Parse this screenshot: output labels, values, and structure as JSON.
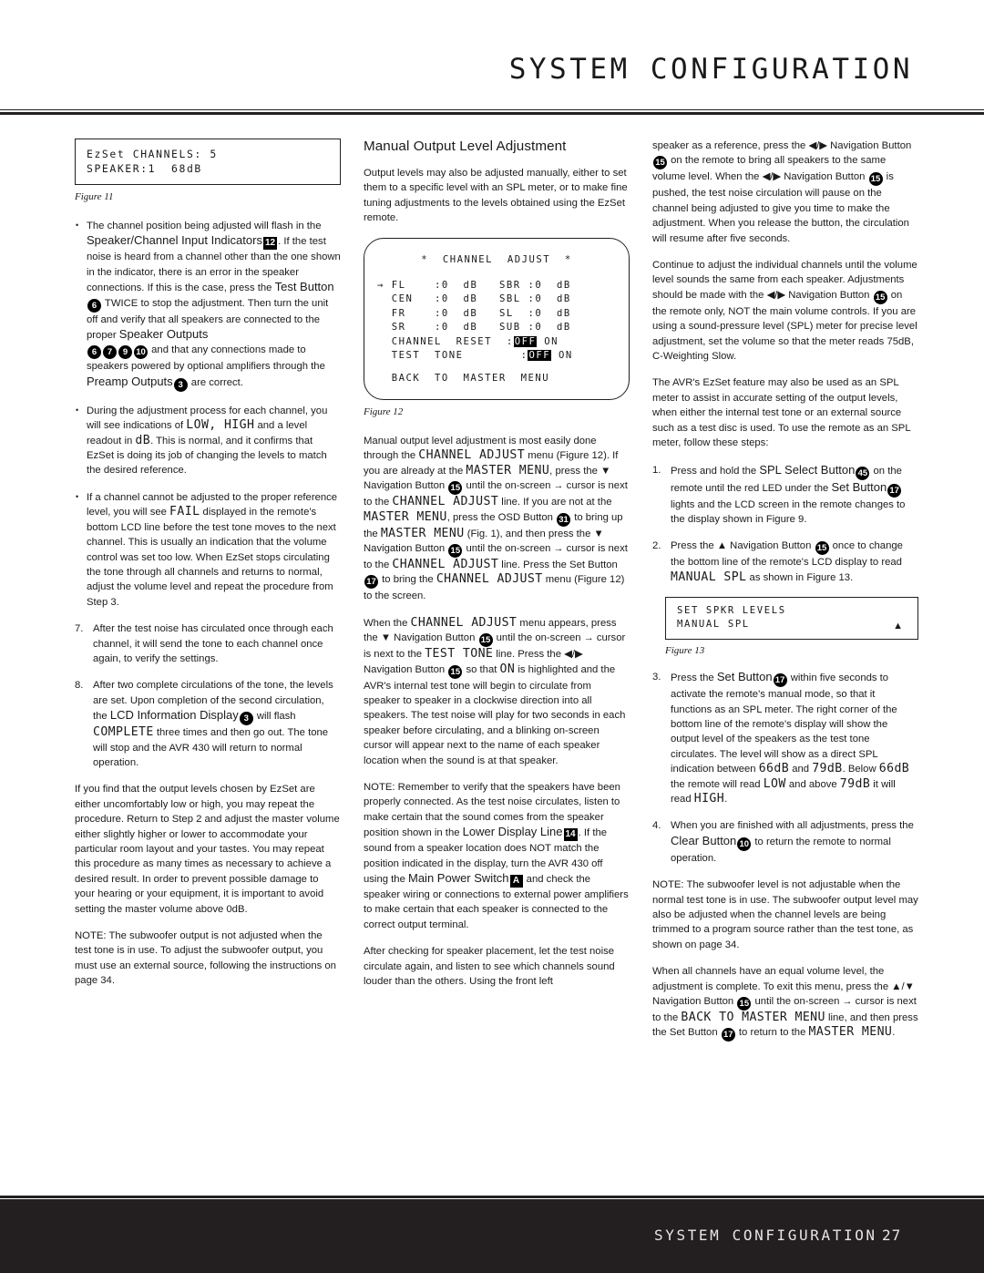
{
  "header": {
    "title": "SYSTEM CONFIGURATION"
  },
  "footer": {
    "title": "SYSTEM CONFIGURATION",
    "page_number": "27"
  },
  "figures": {
    "fig11": {
      "caption": "Figure 11",
      "line1": "EzSet CHANNELS: 5",
      "line2": "SPEAKER:1  68dB"
    },
    "fig12": {
      "caption": "Figure 12",
      "title": "*  CHANNEL  ADJUST  *",
      "cursor": "→",
      "rows": [
        {
          "left": "FL    :0  dB",
          "right": "SBR :0  dB"
        },
        {
          "left": "CEN   :0  dB",
          "right": "SBL :0  dB"
        },
        {
          "left": "FR    :0  dB",
          "right": "SL  :0  dB"
        },
        {
          "left": "SR    :0  dB",
          "right": "SUB :0  dB"
        }
      ],
      "channel_reset_label": "CHANNEL  RESET",
      "channel_reset_sep": ":",
      "channel_reset_selected": "OFF",
      "channel_reset_other": "ON",
      "test_tone_label": "TEST  TONE",
      "test_tone_sep": ":",
      "test_tone_selected": "OFF",
      "test_tone_other": "ON",
      "back_line": "BACK  TO  MASTER  MENU"
    },
    "fig13": {
      "caption": "Figure 13",
      "line1": "SET SPKR LEVELS",
      "line2": "MANUAL SPL",
      "arrow": "▲"
    }
  },
  "left_column": {
    "bullet1": {
      "t1": "The channel position being adjusted will flash in the ",
      "ui1": "Speaker/Channel Input Indicators",
      "ref1": "12",
      "t2": ". If the test noise is heard from a channel other than the one shown in the indicator, there is an error in the speaker connections. If this is the case, press the ",
      "ui2": "Test Button",
      "ref2": "6",
      "t3": " TWICE to stop the adjustment. Then turn the unit off and verify that all speakers are connected to the proper ",
      "ui3": "Speaker Outputs",
      "ref3": "6",
      "ref4": "7",
      "ref5": "9",
      "ref6": "10",
      "t4": " and that any connections made to speakers powered by optional amplifiers through the ",
      "ui4": "Preamp Outputs",
      "ref7": "3",
      "t5": " are correct."
    },
    "bullet2": {
      "t1": "During the adjustment process for each channel, you will see indications of ",
      "lcd1": "LOW, HIGH",
      "t2": " and a level readout in ",
      "lcd2": "dB",
      "t3": ". This is normal, and it confirms that EzSet is doing its job of changing the levels to match the desired reference."
    },
    "bullet3": {
      "t1": "If a channel cannot be adjusted to the proper reference level, you will see ",
      "lcd1": "FAIL",
      "t2": " displayed in the remote's bottom LCD line before the test tone moves to the next channel. This is usually an indication that the volume control was set too low. When EzSet stops circulating the tone through all channels and returns to normal, adjust the volume level and repeat the procedure from Step 3."
    },
    "step7": {
      "num": "7.",
      "text": "After the test noise has circulated once through each channel, it will send the tone to each channel once again, to verify the settings."
    },
    "step8": {
      "num": "8.",
      "t1": "After two complete circulations of the tone, the levels are set. Upon completion of the second circulation, the ",
      "ui1": "LCD Information Display",
      "ref1": "3",
      "t2": " will flash ",
      "lcd1": "COMPLETE",
      "t3": " three times and then go out. The tone will stop and the AVR 430 will return to normal operation."
    },
    "para_repeat": "If you find that the output levels chosen by EzSet are either uncomfortably low or high, you may repeat the procedure. Return to Step 2 and adjust the master volume either slightly higher or lower to accommodate your particular room layout and your tastes. You may repeat this procedure as many times as necessary to achieve a desired result. In order to prevent possible damage to your hearing or your equipment, it is important to avoid setting the master volume above 0dB.",
    "note_sub": "NOTE: The subwoofer output is not adjusted when the test tone is in use. To adjust the subwoofer output, you must use an external source, following the instructions on page 34."
  },
  "middle_column": {
    "heading": "Manual Output Level Adjustment",
    "intro": "Output levels may also be adjusted manually, either to set them to a specific level with an SPL meter, or to make fine tuning adjustments to the levels obtained using the EzSet remote.",
    "para_menu": {
      "t1": "Manual output level adjustment is most easily done through the ",
      "lcd1": "CHANNEL ADJUST",
      "t2": " menu (Figure 12). If you are already at the ",
      "lcd2": "MASTER MENU",
      "t3": ", press the ",
      "tri_down": "▼",
      "t4": " Navigation Button ",
      "ref1": "15",
      "t5": " until the on-screen ",
      "arrow": "→",
      "t6": " cursor is next to the ",
      "lcd3": "CHANNEL ADJUST",
      "t7": " line. If you are not at the ",
      "lcd4": "MASTER MENU",
      "t8": ", press the OSD Button ",
      "ref2": "31",
      "t9": " to bring up the ",
      "lcd5": "MASTER MENU",
      "t10": " (Fig. 1), and then press the ",
      "t11": " Navigation Button ",
      "ref3": "15",
      "t12": " until the on-screen ",
      "t13": " cursor is next to the ",
      "lcd6": "CHANNEL ADJUST",
      "t14": " line. Press the Set Button ",
      "ref4": "17",
      "t15": " to bring the ",
      "lcd7": "CHANNEL ADJUST",
      "t16": " menu (Figure 12) to the screen."
    },
    "para_testtone": {
      "t1": "When the ",
      "lcd1": "CHANNEL ADJUST",
      "t2": " menu appears, press the ",
      "tri_down": "▼",
      "t3": " Navigation Button ",
      "ref1": "15",
      "t4": " until the on-screen ",
      "arrow": "→",
      "t5": " cursor is next to the ",
      "lcd2": "TEST TONE",
      "t6": " line. Press the ",
      "lr": "◀/▶",
      "t7": " Navigation Button ",
      "ref2": "15",
      "t8": " so that ",
      "lcd3": "ON",
      "t9": " is highlighted and the AVR's internal test tone will begin to circulate from speaker to speaker in a clockwise direction into all speakers. The test noise will play for two seconds in each speaker before circulating, and a blinking on-screen cursor will appear next to the name of each speaker location when the sound is at that speaker."
    },
    "note_verify": {
      "t1": "NOTE: Remember to verify that the speakers have been properly connected. As the test noise circulates, listen to make certain that the sound comes from the speaker position shown in the ",
      "ui1": "Lower Display Line",
      "refb1": "14",
      "t2": ". If the sound from a speaker location does NOT match the position indicated in the display, turn the AVR 430 off using the ",
      "ui2": "Main Power Switch",
      "refb2": "A",
      "t3": " and check the speaker wiring or connections to external power amplifiers to make certain that each speaker is connected to the correct output terminal."
    },
    "para_after": "After checking for speaker placement, let the test noise circulate again, and listen to see which channels sound louder than the others. Using the front left"
  },
  "right_column": {
    "para_ref": {
      "t1": "speaker as a reference, press the ",
      "lr": "◀/▶",
      "t2": " Navigation Button ",
      "ref1": "15",
      "t3": " on the remote to bring all speakers to the same volume level. When the ",
      "t4": " Navigation Button ",
      "ref2": "15",
      "t5": " is pushed, the test noise circulation will pause on the channel being adjusted to give you time to make the adjustment. When you release the button, the circulation will resume after five seconds."
    },
    "para_continue": {
      "t1": "Continue to adjust the individual channels until the volume level sounds the same from each speaker. Adjustments should be made with the ",
      "lr": "◀/▶",
      "t2": " Navigation Button ",
      "ref1": "15",
      "t3": " on the remote only, NOT the main volume controls. If you are using a sound-pressure level (SPL) meter for precise level adjustment, set the volume so that the meter reads 75dB, C-Weighting Slow."
    },
    "para_ezset": "The AVR's EzSet feature may also be used as an SPL meter to assist in accurate setting of the output levels, when either the internal test tone or an external source such as a test disc is used. To use the remote as an SPL meter, follow these steps:",
    "step1": {
      "num": "1.",
      "t1": "Press and hold the ",
      "ui1": "SPL Select Button",
      "ref1": "45",
      "t2": " on the remote until the red LED under the ",
      "ui2": "Set Button",
      "ref2": "17",
      "t3": " lights and the LCD screen in the remote changes to the display shown in Figure 9."
    },
    "step2": {
      "num": "2.",
      "t1": "Press the ",
      "tri_up": "▲",
      "t2": " Navigation Button ",
      "ref1": "15",
      "t3": " once to change the bottom line of the remote's LCD display to read ",
      "lcd1": "MANUAL SPL",
      "t4": " as shown in Figure 13."
    },
    "step3": {
      "num": "3.",
      "t1": "Press the ",
      "ui1": "Set Button",
      "ref1": "17",
      "t2": " within five seconds to activate the remote's manual mode, so that it functions as an SPL meter. The right corner of the bottom line of the remote's display will show the output level of the speakers as the test tone circulates. The level will show as a direct SPL indication between ",
      "lcd1": "66dB",
      "t3": " and ",
      "lcd2": "79dB",
      "t4": ". Below ",
      "lcd3": "66dB",
      "t5": " the remote will read ",
      "lcd4": "LOW",
      "t6": " and above ",
      "lcd5": "79dB",
      "t7": " it will read ",
      "lcd6": "HIGH",
      "t8": "."
    },
    "step4": {
      "num": "4.",
      "t1": "When you are finished with all adjustments, press the ",
      "ui1": "Clear Button",
      "ref1": "10",
      "t2": " to return the remote to normal operation."
    },
    "note_sub": "NOTE: The subwoofer level is not adjustable when the normal test tone is in use. The subwoofer output level may also be adjusted when the channel levels are being trimmed to a program source rather than the test tone, as shown on page 34.",
    "para_exit": {
      "t1": "When all channels have an equal volume level, the adjustment is complete. To exit this menu, press the ",
      "updown": "▲/▼",
      "t2": " Navigation Button ",
      "ref1": "15",
      "t3": " until the on-screen ",
      "arrow": "→",
      "t4": " cursor is next to the ",
      "lcd1": "BACK TO MASTER MENU",
      "t5": " line, and then press the Set Button ",
      "ref2": "17",
      "t6": " to return to the ",
      "lcd2": "MASTER MENU",
      "t7": "."
    }
  }
}
